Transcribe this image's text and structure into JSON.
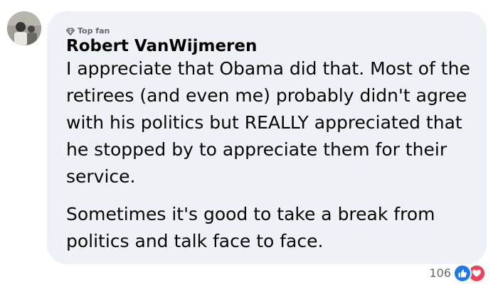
{
  "comment": {
    "badge": {
      "icon": "diamond-icon",
      "label": "Top fan"
    },
    "author": "Robert VanWijmeren",
    "paragraphs": [
      "I appreciate that Obama did that. Most of the retirees (and even me) probably didn't agree with his politics but REALLY appreciated that he stopped by to appreciate them for their service.",
      "Sometimes it's good to take a break from politics and talk face to face."
    ],
    "reactions": {
      "count": "106",
      "icons": [
        "like-icon",
        "love-icon"
      ]
    }
  },
  "colors": {
    "bubble": "#eef2f7",
    "text": "#050505",
    "muted": "#65676b",
    "like": "#1877f2",
    "love": "#f33e58"
  }
}
